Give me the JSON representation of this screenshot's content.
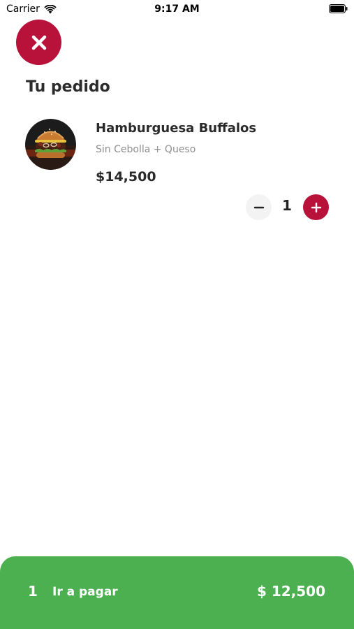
{
  "status_bar": {
    "carrier": "Carrier",
    "time": "9:17 AM"
  },
  "header": {
    "close_icon": "close-icon",
    "title": "Tu pedido"
  },
  "cart": {
    "items": [
      {
        "name": "Hamburguesa Buffalos",
        "options": "Sin Cebolla + Queso",
        "price": "$14,500",
        "quantity": "1",
        "image_icon": "burger-image"
      }
    ]
  },
  "checkout": {
    "count": "1",
    "label": "Ir a pagar",
    "total": "$ 12,500"
  },
  "colors": {
    "accent": "#b8113a",
    "checkout_bg": "#4caf50",
    "quantity_minus_bg": "#f3f3f3"
  }
}
